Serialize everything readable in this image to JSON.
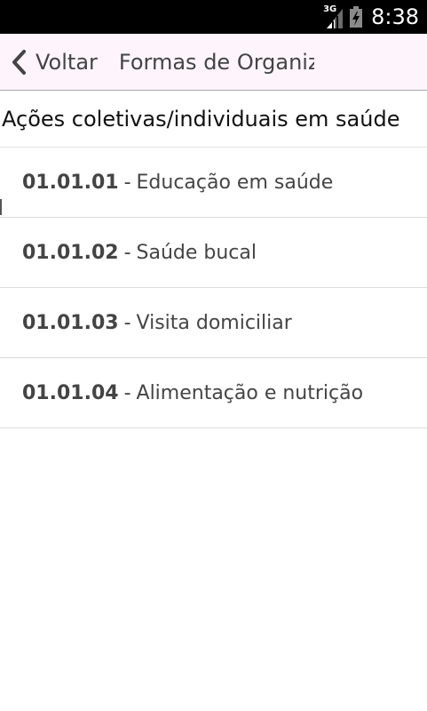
{
  "status_bar": {
    "network": "3G",
    "time": "8:38"
  },
  "header": {
    "back_label": "Voltar",
    "title": "Formas de Organiz."
  },
  "section": {
    "heading": "Ações coletivas/individuais em saúde"
  },
  "items": [
    {
      "code": "01.01.01",
      "separator": "-",
      "label": "Educação em saúde"
    },
    {
      "code": "01.01.02",
      "separator": "-",
      "label": "Saúde bucal"
    },
    {
      "code": "01.01.03",
      "separator": "-",
      "label": "Visita domiciliar"
    },
    {
      "code": "01.01.04",
      "separator": "-",
      "label": "Alimentação e nutrição"
    }
  ],
  "colors": {
    "status_bar_bg": "#000000",
    "header_bg": "#fdf5fb",
    "text_primary": "#444444"
  }
}
